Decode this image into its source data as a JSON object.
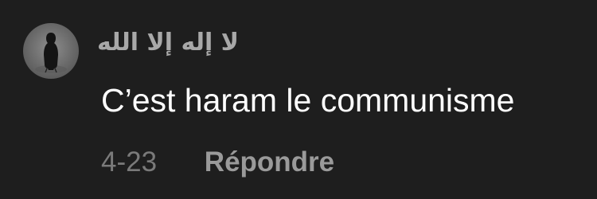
{
  "comment": {
    "avatar_icon": "user-avatar-figure-icon",
    "username": "لا إله إلا الله",
    "text": "C’est haram le communisme",
    "date": "4-23",
    "reply_label": "Répondre"
  },
  "colors": {
    "background": "#1e1e1e",
    "username": "#a8a8a8",
    "text": "#ffffff",
    "date": "#7a7a7a",
    "reply": "#9a9a9a"
  }
}
